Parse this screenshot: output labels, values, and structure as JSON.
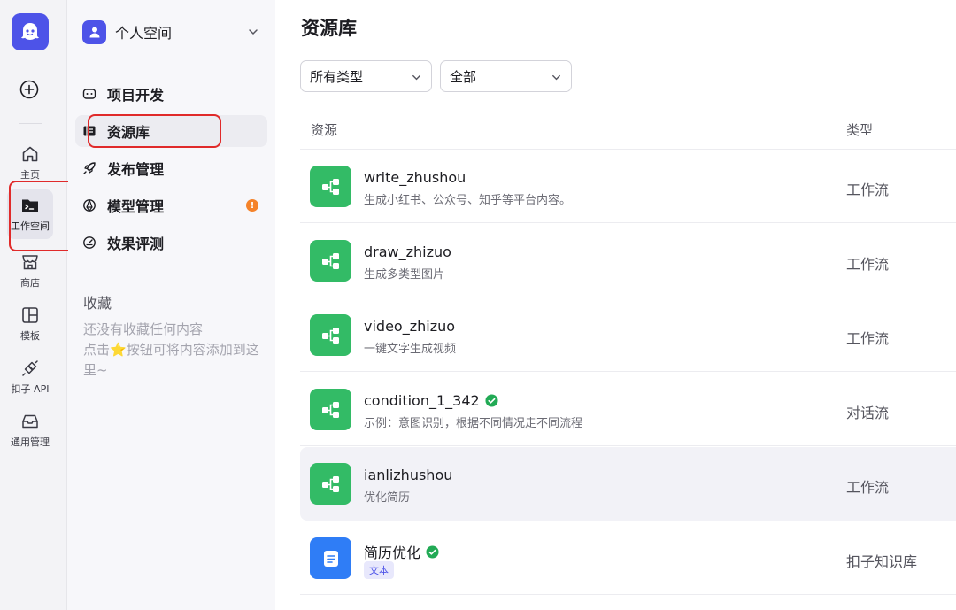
{
  "rail": {
    "items": [
      {
        "label": "主页",
        "icon": "home-icon"
      },
      {
        "label": "工作空间",
        "icon": "terminal-folder-icon"
      },
      {
        "label": "商店",
        "icon": "store-icon"
      },
      {
        "label": "模板",
        "icon": "template-icon"
      },
      {
        "label": "扣子 API",
        "icon": "api-icon"
      },
      {
        "label": "通用管理",
        "icon": "inbox-icon"
      }
    ]
  },
  "sidebar": {
    "space_name": "个人空间",
    "nav": [
      {
        "label": "项目开发",
        "icon": "robot-icon"
      },
      {
        "label": "资源库",
        "icon": "library-icon"
      },
      {
        "label": "发布管理",
        "icon": "rocket-icon"
      },
      {
        "label": "模型管理",
        "icon": "model-icon",
        "badge": "!"
      },
      {
        "label": "效果评测",
        "icon": "gauge-icon"
      }
    ],
    "favorites_title": "收藏",
    "favorites_empty": {
      "line1": "还没有收藏任何内容",
      "line2a": "点击",
      "star": "⭐",
      "line2b": "按钮可将内容添加到这里~"
    }
  },
  "main": {
    "title": "资源库",
    "filters": [
      {
        "value": "所有类型"
      },
      {
        "value": "全部"
      }
    ],
    "columns": {
      "resource": "资源",
      "type": "类型"
    },
    "rows": [
      {
        "name": "write_zhushou",
        "desc": "生成小红书、公众号、知乎等平台内容。",
        "type": "工作流"
      },
      {
        "name": "draw_zhizuo",
        "desc": "生成多类型图片",
        "type": "工作流"
      },
      {
        "name": "video_zhizuo",
        "desc": "一键文字生成视频",
        "type": "工作流"
      },
      {
        "name": "condition_1_342",
        "desc": "示例：意图识别，根据不同情况走不同流程",
        "type": "对话流"
      },
      {
        "name": "ianlizhushou",
        "desc": "优化简历",
        "type": "工作流"
      },
      {
        "name": "简历优化",
        "tag": "文本",
        "type": "扣子知识库"
      }
    ]
  },
  "colors": {
    "brand": "#4d53e8",
    "workflow_green": "#33bb66",
    "knowledge_blue": "#2f7df6",
    "highlight_red": "#e02a2a",
    "badge_orange": "#f5832a",
    "verified_green": "#22aa55"
  }
}
